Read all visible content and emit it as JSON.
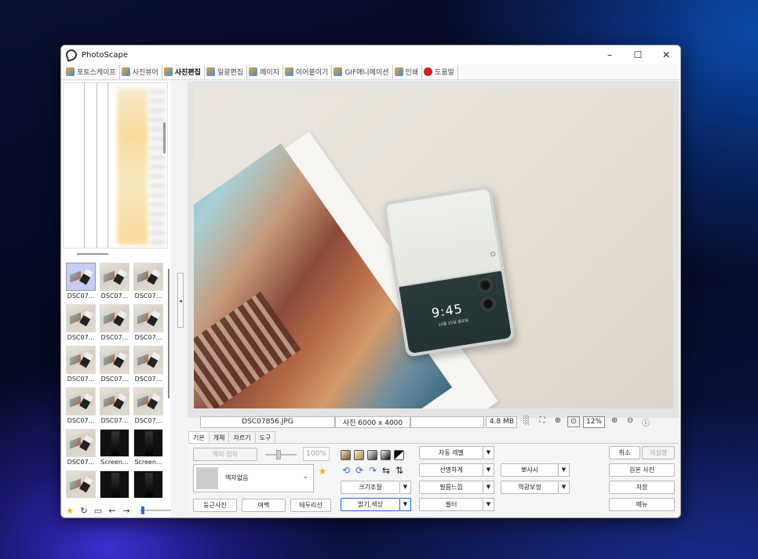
{
  "window": {
    "title": "PhotoScape",
    "controls": [
      "–",
      "☐",
      "✕"
    ]
  },
  "tabs": [
    {
      "label": "포토스케이프",
      "icon": "photoscape-icon"
    },
    {
      "label": "사진뷰어",
      "icon": "viewer-icon"
    },
    {
      "label": "사진편집",
      "icon": "editor-icon",
      "active": true
    },
    {
      "label": "일괄편집",
      "icon": "batch-icon"
    },
    {
      "label": "페이지",
      "icon": "page-icon"
    },
    {
      "label": "이어붙이기",
      "icon": "combine-icon"
    },
    {
      "label": "GIF애니메이션",
      "icon": "gif-icon"
    },
    {
      "label": "인쇄",
      "icon": "print-icon"
    },
    {
      "label": "도움말",
      "icon": "help-icon"
    }
  ],
  "thumbnails": [
    {
      "label": "DSC07...",
      "kind": "photo",
      "selected": true
    },
    {
      "label": "DSC07...",
      "kind": "photo"
    },
    {
      "label": "DSC07...",
      "kind": "photo"
    },
    {
      "label": "DSC07...",
      "kind": "photo"
    },
    {
      "label": "DSC07...",
      "kind": "photo"
    },
    {
      "label": "DSC07...",
      "kind": "photo"
    },
    {
      "label": "DSC07...",
      "kind": "photo"
    },
    {
      "label": "DSC07...",
      "kind": "photo"
    },
    {
      "label": "DSC07...",
      "kind": "photo"
    },
    {
      "label": "DSC07...",
      "kind": "photo"
    },
    {
      "label": "DSC07...",
      "kind": "photo"
    },
    {
      "label": "DSC07...",
      "kind": "photo"
    },
    {
      "label": "DSC07...",
      "kind": "photo"
    },
    {
      "label": "Screen...",
      "kind": "dark"
    },
    {
      "label": "Screen...",
      "kind": "dark"
    },
    {
      "label": "",
      "kind": "photo"
    },
    {
      "label": "",
      "kind": "dark"
    },
    {
      "label": "",
      "kind": "dark"
    }
  ],
  "preview": {
    "phone_time": "9:45",
    "phone_date": "10월 25일 월요일"
  },
  "status": {
    "filename": "DSC07856.JPG",
    "dimensions": "사진 6000 x 4000",
    "filesize": "4.8 MB",
    "zoom": "12%"
  },
  "subtabs": [
    "기본",
    "개체",
    "자르기",
    "도구"
  ],
  "basic": {
    "frame_merge": "액자 접착",
    "frame_pct": "100%",
    "frame_value": "액자없음",
    "round_photo": "둥근사진",
    "margin": "여백",
    "border": "테두리선"
  },
  "adjust": {
    "auto_level": "자동 레벨",
    "sharpen": "선명하게",
    "resize": "크기조절",
    "film": "필름느낌",
    "brightness": "밝기,색상",
    "filter": "필터",
    "mosaic": "뽀샤시",
    "backlight": "역광보정"
  },
  "actions": {
    "undo": "취소",
    "redo": "재실행",
    "original": "원본 사진",
    "save": "저장",
    "menu": "메뉴"
  },
  "colors": {
    "accent": "#1a6ad8",
    "help_red": "#d02020"
  }
}
